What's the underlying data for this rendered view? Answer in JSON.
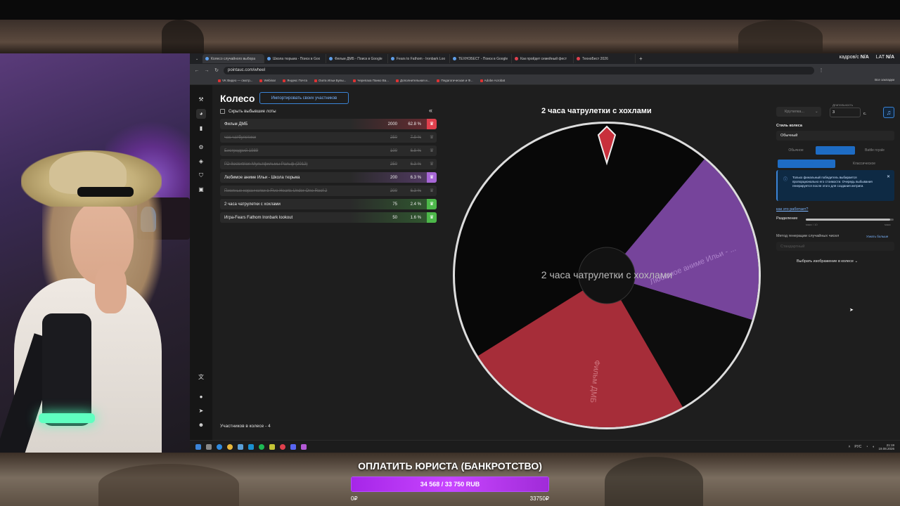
{
  "browser": {
    "tabs": [
      {
        "label": "Колесо случайного выбора",
        "active": true
      },
      {
        "label": "Школа тюрьма - Поиск в Goo"
      },
      {
        "label": "Фильм ДМБ - Поиск в Google"
      },
      {
        "label": "Fears to Fathom - Ironbark Loo"
      },
      {
        "label": "ТЕХНОБЕСТ - Поиск в Google"
      },
      {
        "label": "Как пройдет семейный фест"
      },
      {
        "label": "ТехноБест 2026"
      }
    ],
    "new_tab": "+",
    "url": "pointauc.com/wheel",
    "bookmarks": [
      "VK Видео — смотр...",
      "Webinar",
      "Яндекс Почта",
      "Ourra Ильи Булы...",
      "Черепаха Панко Ва...",
      "Дополнительная и...",
      "Педагогическая и Ф...",
      "Adobe Acrobat"
    ],
    "all_bookmarks": "Все закладки"
  },
  "obs_stats": {
    "frames_label": "кадров/с",
    "frames_value": "N/A",
    "latency_label": "LAT",
    "latency_value": "N/A"
  },
  "app": {
    "title": "Колесо",
    "import_button": "Импортировать своих участников",
    "hide_winners": "Скрыть выбывшие лоты",
    "collapse": "«",
    "lots": [
      {
        "name": "Фильм ДМБ",
        "amount": "2000",
        "pct": "62.8 %",
        "color": "#e0404d",
        "state": "active"
      },
      {
        "name": "час чатбулетики",
        "amount": "250",
        "pct": "7.9 %",
        "state": "eliminated"
      },
      {
        "name": "Бистродрий 1989",
        "amount": "100",
        "pct": "6.8 %",
        "state": "eliminated"
      },
      {
        "name": "ГО Ilostertrion Мультфильмы Ральф (2012)",
        "amount": "250",
        "pct": "6.3 %",
        "state": "eliminated"
      },
      {
        "name": "Любимое аниме Ильи - Школа тюрьма",
        "amount": "200",
        "pct": "6.3 %",
        "color": "#a767d6",
        "state": "active"
      },
      {
        "name": "Пиелные коранчелки в Five Hearts Under One Roof 2",
        "amount": "200",
        "pct": "6.3 %",
        "state": "eliminated"
      },
      {
        "name": "2 часа чатрулетки с хохлами",
        "amount": "75",
        "pct": "2.4 %",
        "color": "#4db84a",
        "state": "active"
      },
      {
        "name": "Игра-Fears Fathom Ironbark lookout",
        "amount": "50",
        "pct": "1.6 %",
        "color": "#4db84a",
        "state": "active"
      }
    ],
    "participants": "Участников в колесе - 4",
    "wheel_title": "2 часа чатрулетки с хохлами",
    "wheel_center_text": "2 часа чатрулетки с хохлами",
    "wheel_labels": {
      "anime": "Любимое аниме Ильи - ...",
      "dmb": "Фильм ДМБ"
    },
    "settings": {
      "spin_select": "Крутилка...",
      "duration_label": "Длительность",
      "duration_value": "3",
      "duration_unit": "с.",
      "style_label": "Стиль колеса",
      "style_value": "Обычный",
      "modes": [
        "Обычное",
        "На выбывание",
        "Battle royale"
      ],
      "views": [
        "Обычное",
        "Классическое"
      ],
      "info": "Только финальный победитель выбирается пропорционально его стоимости. Очередь выбывания генерируется после этого для создания интриги.",
      "how_link": "как это работает?",
      "split_label": "Разделение",
      "split_min": "макс / 10",
      "split_max": "макс",
      "split_fraction": 0.96,
      "rng_label": "Метод генерации случайных чисел",
      "rng_more": "Узнать больше",
      "rng_value": "Стандартный",
      "image_select": "Выбрать изображение в колесе"
    }
  },
  "taskbar": {
    "lang": "РУС",
    "time": "21:19",
    "date": "19.08.2026"
  },
  "goal": {
    "title": "ОПЛАТИТЬ ЮРИСТА (БАНКРОТСТВО)",
    "progress_text": "34 568 / 33 750 RUB",
    "progress_fraction": 1.0,
    "min": "0₽",
    "max": "33750₽"
  },
  "colors": {
    "accent": "#3b84d6",
    "dmb_slice": "#b8323f",
    "anime_slice": "#8a4fb5",
    "goal": "#b83cf0"
  }
}
